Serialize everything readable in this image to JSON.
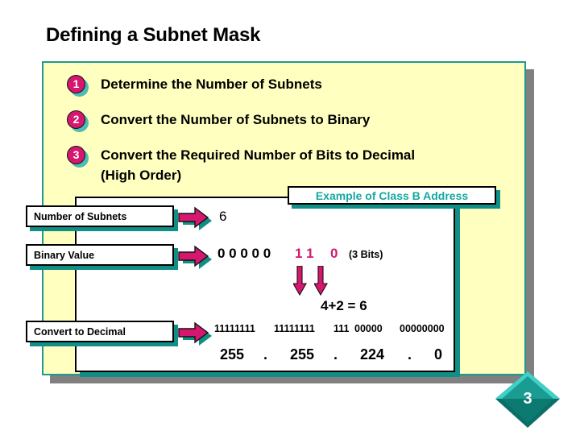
{
  "slide": {
    "title": "Defining a Subnet Mask",
    "page_number": "3",
    "colors": {
      "panel_background": "#ffffbf",
      "panel_border": "#1f9a8f",
      "accent_magenta": "#d6176f",
      "accent_teal": "#13a8a0",
      "shadow_gray": "#808080"
    }
  },
  "steps": [
    {
      "number": "1",
      "text": "Determine the Number of Subnets"
    },
    {
      "number": "2",
      "text": "Convert the Number of Subnets to Binary"
    },
    {
      "number": "3",
      "text": "Convert the Required Number of Bits to Decimal",
      "text2": "(High Order)"
    }
  ],
  "example": {
    "label": "Example of Class B Address"
  },
  "rows": [
    {
      "label": "Number of Subnets",
      "icon": "right-arrow-icon"
    },
    {
      "label": "Binary Value",
      "icon": "right-arrow-icon"
    },
    {
      "label": "Convert to Decimal",
      "icon": "right-arrow-icon"
    }
  ],
  "values": {
    "number_of_subnets": "6",
    "binary_zeros": "0  0  0  0  0",
    "binary_ones": "1  1",
    "binary_last": "0",
    "bits_note": "(3 Bits)",
    "sum_line": "4+2  = 6",
    "mask_octet1": "11111111",
    "mask_octet2": "11111111",
    "mask_octet3_network": "111",
    "mask_octet3_host": "00000",
    "mask_octet4": "00000000",
    "decimal1": "255",
    "dot1": ".",
    "decimal2": "255",
    "dot2": ".",
    "decimal3": "224",
    "dot3": ".",
    "decimal4": "0"
  }
}
